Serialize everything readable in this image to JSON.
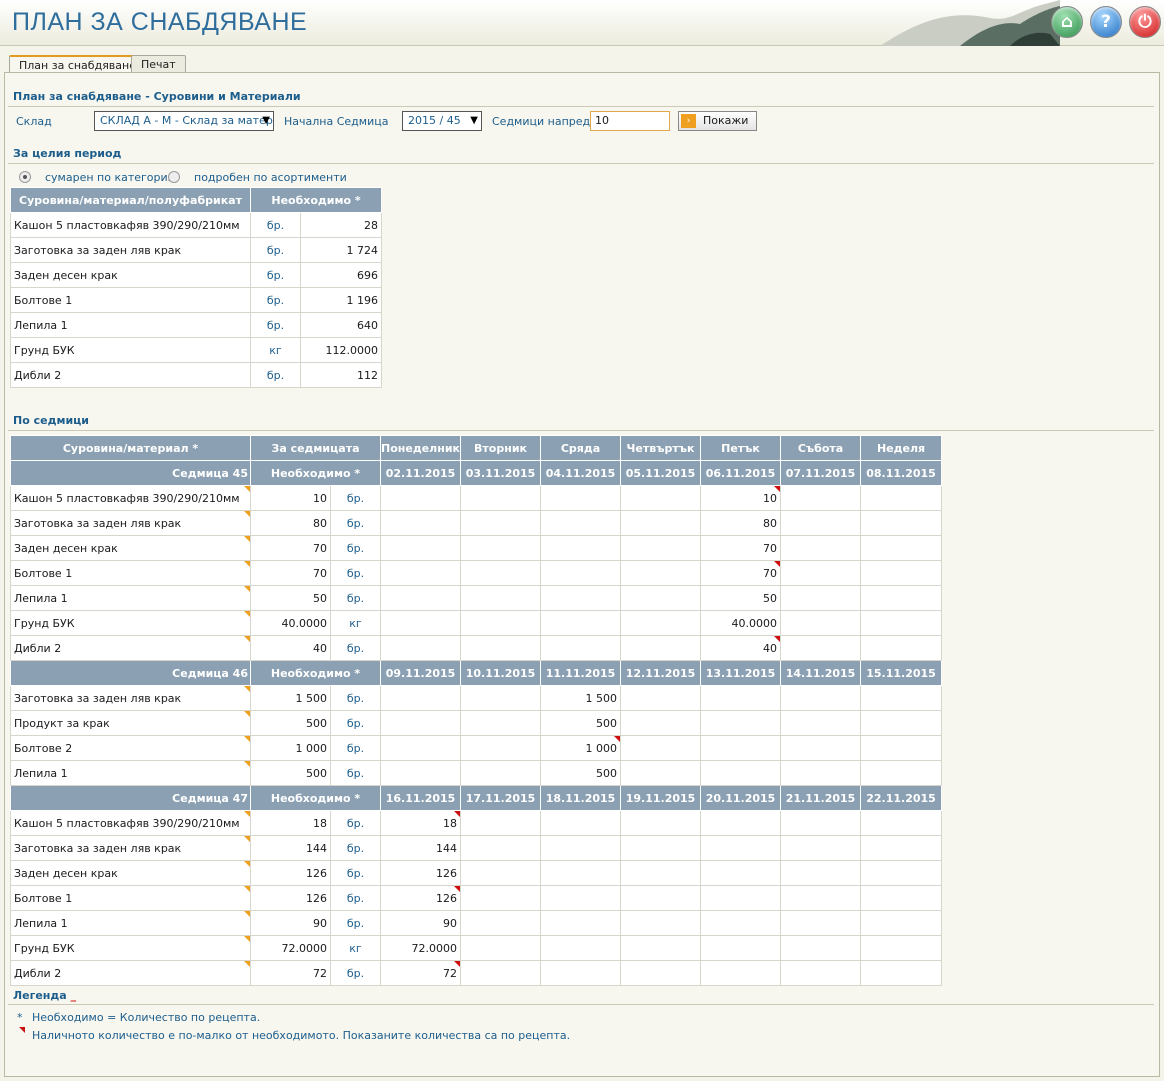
{
  "app": {
    "title": "ПЛАН ЗА СНАБДЯВАНЕ"
  },
  "tabs": [
    {
      "label": "План за снабдяване"
    },
    {
      "label": "Печат"
    }
  ],
  "section_main": {
    "title": "План за снабдяване - Суровини и Материали"
  },
  "filters": {
    "warehouse_label": "Склад",
    "warehouse_value": "СКЛАД А - М - Склад за матер",
    "start_week_label": "Начална Седмица",
    "start_week_value": "2015 / 45",
    "weeks_ahead_label": "Седмици напред",
    "weeks_ahead_value": "10",
    "show_button": "Покажи"
  },
  "period": {
    "title": "За целия период",
    "radio_summary": "сумарен по категории",
    "radio_detailed": "подробен по асортименти",
    "headers": [
      "Суровина/материал/полуфабрикат",
      "Необходимо *"
    ],
    "rows": [
      {
        "name": "Кашон 5 пластовкафяв 390/290/210мм",
        "unit": "бр.",
        "qty": "28"
      },
      {
        "name": "Заготовка за заден ляв крак",
        "unit": "бр.",
        "qty": "1 724"
      },
      {
        "name": "Заден десен крак",
        "unit": "бр.",
        "qty": "696"
      },
      {
        "name": "Болтове 1",
        "unit": "бр.",
        "qty": "1 196"
      },
      {
        "name": "Лепила 1",
        "unit": "бр.",
        "qty": "640"
      },
      {
        "name": "Грунд БУК",
        "unit": "кг",
        "qty": "112.0000"
      },
      {
        "name": "Дибли 2",
        "unit": "бр.",
        "qty": "112"
      }
    ]
  },
  "weekly": {
    "title": "По седмици",
    "headers": [
      "Суровина/материал *",
      "За седмицата",
      "Понеделник",
      "Вторник",
      "Сряда",
      "Четвъртък",
      "Петък",
      "Събота",
      "Неделя"
    ],
    "weeks": [
      {
        "label": "Седмица 45",
        "needed": "Необходимо *",
        "dates": [
          "02.11.2015",
          "03.11.2015",
          "04.11.2015",
          "05.11.2015",
          "06.11.2015",
          "07.11.2015",
          "08.11.2015"
        ],
        "rows": [
          {
            "name": "Кашон 5 пластовкафяв 390/290/210мм",
            "total": "10",
            "unit": "бр.",
            "day": 4,
            "val": "10",
            "flag": "red"
          },
          {
            "name": "Заготовка за заден ляв крак",
            "total": "80",
            "unit": "бр.",
            "day": 4,
            "val": "80",
            "flag": ""
          },
          {
            "name": "Заден десен крак",
            "total": "70",
            "unit": "бр.",
            "day": 4,
            "val": "70",
            "flag": ""
          },
          {
            "name": "Болтове 1",
            "total": "70",
            "unit": "бр.",
            "day": 4,
            "val": "70",
            "flag": "red"
          },
          {
            "name": "Лепила 1",
            "total": "50",
            "unit": "бр.",
            "day": 4,
            "val": "50",
            "flag": ""
          },
          {
            "name": "Грунд БУК",
            "total": "40.0000",
            "unit": "кг",
            "day": 4,
            "val": "40.0000",
            "flag": ""
          },
          {
            "name": "Дибли 2",
            "total": "40",
            "unit": "бр.",
            "day": 4,
            "val": "40",
            "flag": "red"
          }
        ]
      },
      {
        "label": "Седмица 46",
        "needed": "Необходимо *",
        "dates": [
          "09.11.2015",
          "10.11.2015",
          "11.11.2015",
          "12.11.2015",
          "13.11.2015",
          "14.11.2015",
          "15.11.2015"
        ],
        "rows": [
          {
            "name": "Заготовка за заден ляв крак",
            "total": "1 500",
            "unit": "бр.",
            "day": 2,
            "val": "1 500",
            "flag": ""
          },
          {
            "name": "Продукт за крак",
            "total": "500",
            "unit": "бр.",
            "day": 2,
            "val": "500",
            "flag": ""
          },
          {
            "name": "Болтове 2",
            "total": "1 000",
            "unit": "бр.",
            "day": 2,
            "val": "1 000",
            "flag": "red"
          },
          {
            "name": "Лепила 1",
            "total": "500",
            "unit": "бр.",
            "day": 2,
            "val": "500",
            "flag": ""
          }
        ]
      },
      {
        "label": "Седмица 47",
        "needed": "Необходимо *",
        "dates": [
          "16.11.2015",
          "17.11.2015",
          "18.11.2015",
          "19.11.2015",
          "20.11.2015",
          "21.11.2015",
          "22.11.2015"
        ],
        "rows": [
          {
            "name": "Кашон 5 пластовкафяв 390/290/210мм",
            "total": "18",
            "unit": "бр.",
            "day": 0,
            "val": "18",
            "flag": "red"
          },
          {
            "name": "Заготовка за заден ляв крак",
            "total": "144",
            "unit": "бр.",
            "day": 0,
            "val": "144",
            "flag": ""
          },
          {
            "name": "Заден десен крак",
            "total": "126",
            "unit": "бр.",
            "day": 0,
            "val": "126",
            "flag": ""
          },
          {
            "name": "Болтове 1",
            "total": "126",
            "unit": "бр.",
            "day": 0,
            "val": "126",
            "flag": "red"
          },
          {
            "name": "Лепила 1",
            "total": "90",
            "unit": "бр.",
            "day": 0,
            "val": "90",
            "flag": ""
          },
          {
            "name": "Грунд БУК",
            "total": "72.0000",
            "unit": "кг",
            "day": 0,
            "val": "72.0000",
            "flag": ""
          },
          {
            "name": "Дибли 2",
            "total": "72",
            "unit": "бр.",
            "day": 0,
            "val": "72",
            "flag": "red"
          }
        ]
      }
    ]
  },
  "legend": {
    "title": "Легенда",
    "star": "*",
    "line1": "Необходимо = Количество по рецепта.",
    "line2": "Наличното количество е по-малко от необходимото. Показаните количества са по рецепта."
  }
}
